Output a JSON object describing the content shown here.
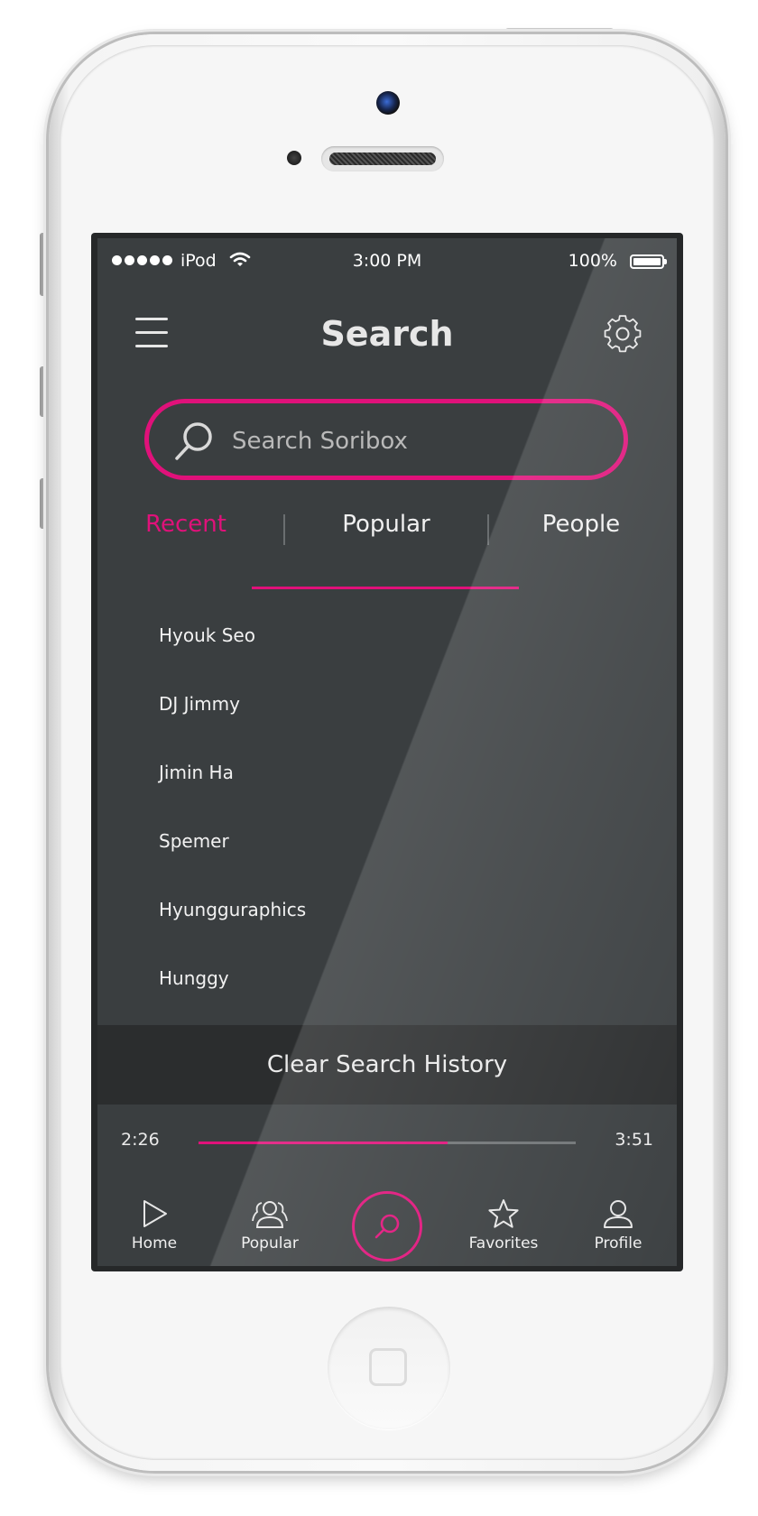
{
  "status_bar": {
    "carrier": "iPod",
    "time": "3:00 PM",
    "battery": "100%"
  },
  "header": {
    "title": "Search",
    "menu_icon": "hamburger-menu-icon",
    "settings_icon": "gear-icon"
  },
  "search": {
    "placeholder": "Search Soribox",
    "value": "",
    "icon": "search-icon"
  },
  "tabs": [
    {
      "label": "Recent",
      "active": true
    },
    {
      "label": "Popular",
      "active": false
    },
    {
      "label": "People",
      "active": false
    }
  ],
  "recent_searches": [
    "Hyouk Seo",
    "DJ Jimmy",
    "Jimin Ha",
    "Spemer",
    "Hyungguraphics",
    "Hunggy"
  ],
  "clear_history_label": "Clear Search History",
  "player": {
    "elapsed": "2:26",
    "duration": "3:51",
    "progress_fraction": 0.66
  },
  "tabbar": [
    {
      "label": "Home",
      "icon": "play-icon"
    },
    {
      "label": "Popular",
      "icon": "people-icon"
    },
    {
      "label": "",
      "icon": "search-icon",
      "active": true
    },
    {
      "label": "Favorites",
      "icon": "star-icon"
    },
    {
      "label": "Profile",
      "icon": "user-icon"
    }
  ],
  "colors": {
    "accent": "#e0117a",
    "screen_bg": "#3a3e40",
    "clear_bar_bg": "#2b2d2e",
    "device_body": "#f6f6f6"
  }
}
